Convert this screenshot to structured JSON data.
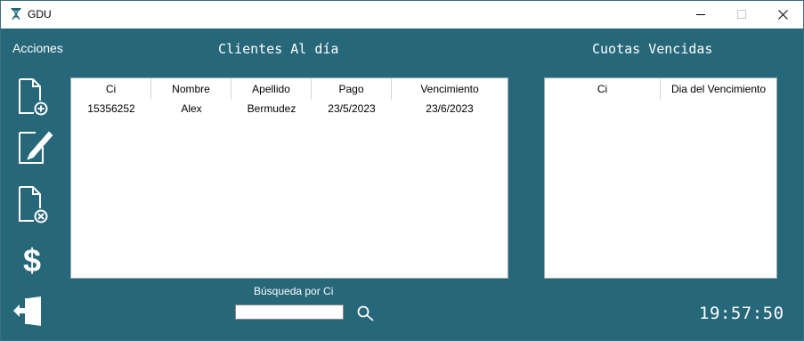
{
  "window": {
    "title": "GDU",
    "icon": "app-logo-icon",
    "controls": [
      "minimize-icon",
      "maximize-icon",
      "close-icon"
    ]
  },
  "sidebar": {
    "heading": "Acciones",
    "items": [
      {
        "icon": "add-document-icon"
      },
      {
        "icon": "edit-document-icon"
      },
      {
        "icon": "delete-document-icon"
      },
      {
        "icon": "dollar-icon"
      },
      {
        "icon": "exit-icon"
      }
    ]
  },
  "clientes": {
    "heading": "Clientes Al día",
    "columns": [
      "Ci",
      "Nombre",
      "Apellido",
      "Pago",
      "Vencimiento"
    ],
    "rows": [
      [
        "15356252",
        "Alex",
        "Bermudez",
        "23/5/2023",
        "23/6/2023"
      ]
    ]
  },
  "cuotas": {
    "heading": "Cuotas Vencidas",
    "columns": [
      "Ci",
      "Dia del Vencimiento"
    ],
    "rows": []
  },
  "search": {
    "label": "Búsqueda por Ci",
    "value": "",
    "icon": "search-icon"
  },
  "clock": {
    "time": "19:57:50"
  },
  "colors": {
    "background": "#27677a",
    "panel": "#ffffff",
    "text_light": "#ffffff"
  }
}
